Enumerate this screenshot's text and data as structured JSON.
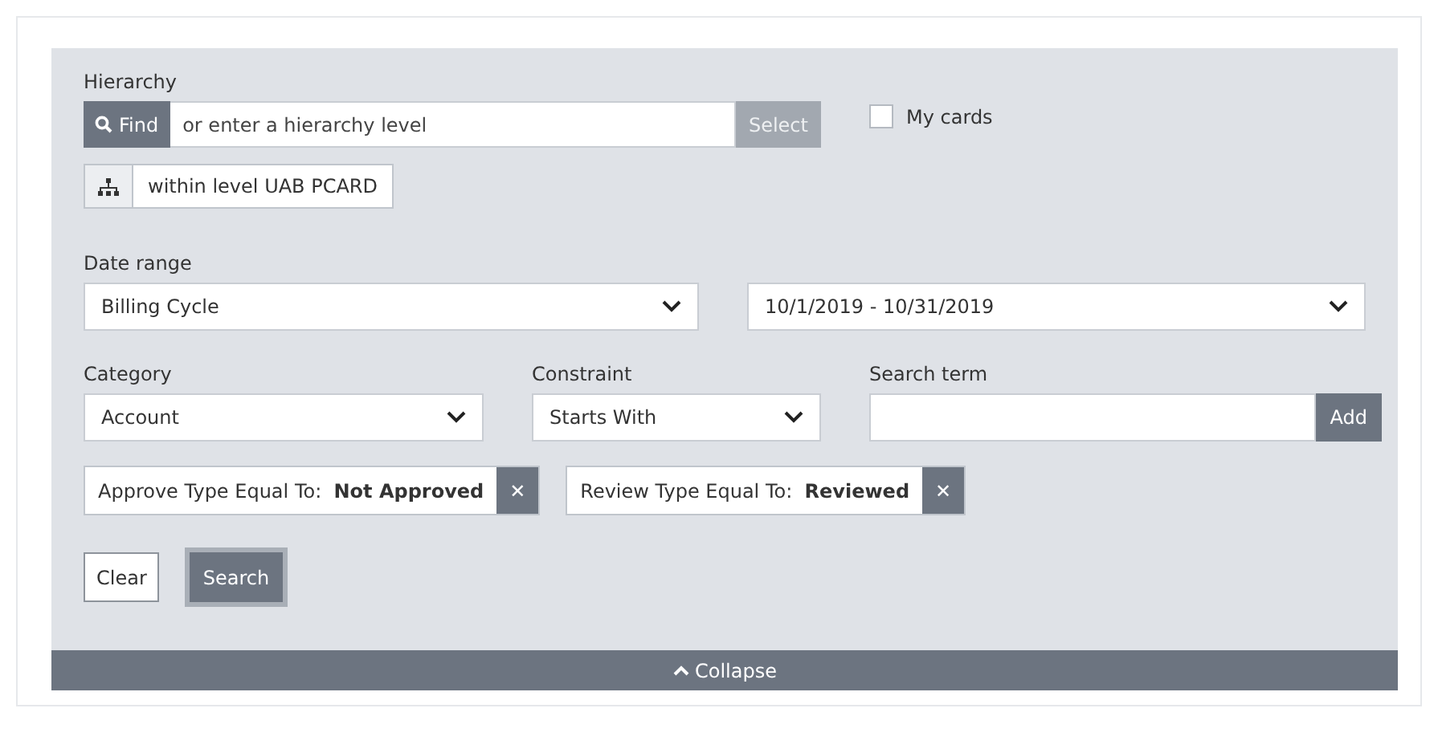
{
  "hierarchy": {
    "label": "Hierarchy",
    "find_button": "Find",
    "placeholder": "or enter a hierarchy level",
    "select_button": "Select",
    "level_button": "within level UAB PCARD"
  },
  "my_cards": {
    "label": "My cards",
    "checked": false
  },
  "date_range": {
    "label": "Date range",
    "type_value": "Billing Cycle",
    "range_value": "10/1/2019 - 10/31/2019"
  },
  "category": {
    "label": "Category",
    "value": "Account"
  },
  "constraint": {
    "label": "Constraint",
    "value": "Starts With"
  },
  "search_term": {
    "label": "Search term",
    "add_button": "Add"
  },
  "filters": [
    {
      "text": "Approve Type Equal To:  **Not Approved**",
      "remove": "✕"
    },
    {
      "text": "Review Type Equal To:  **Reviewed**",
      "remove": "✕"
    }
  ],
  "buttons": {
    "clear": "Clear",
    "search": "Search"
  },
  "collapse": "Collapse"
}
